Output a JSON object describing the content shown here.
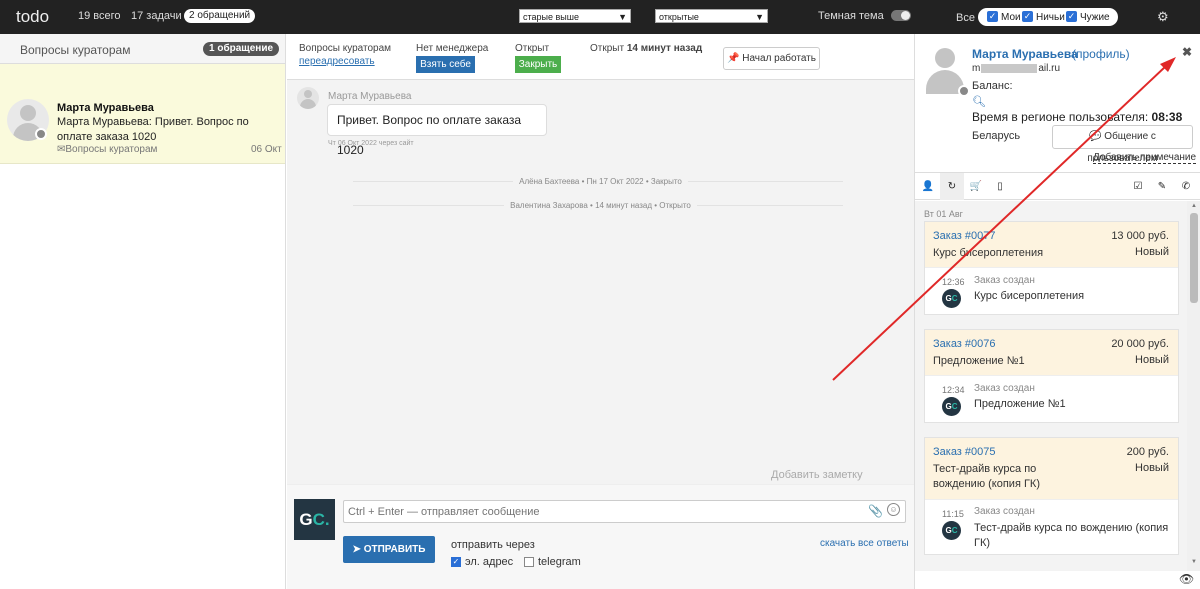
{
  "topbar": {
    "logo": "todo",
    "total": "19 всего",
    "tasks": "17 задачи",
    "requests_pill": "2 обращений",
    "sort_select": "старые выше",
    "status_select": "открытые",
    "dark_theme": "Темная тема",
    "all_label": "Все",
    "filter_mine": "Мои",
    "filter_nobody": "Ничьи",
    "filter_others": "Чужие"
  },
  "left_panel": {
    "title": "Вопросы кураторам",
    "badge": "1 обращение",
    "ticket": {
      "name": "Марта Муравьева",
      "snippet": "Марта Муравьева: Привет. Вопрос по оплате заказа 1020",
      "folder": "Вопросы кураторам",
      "date": "06 Окт"
    }
  },
  "thread_header": {
    "department_label": "Вопросы кураторам",
    "redirect_link": "переадресовать",
    "manager_label": "Нет менеджера",
    "take_button": "Взять себе",
    "state_label": "Открыт",
    "close_button": "Закрыть",
    "opened_prefix": "Открыт",
    "opened_time": "14 минут назад",
    "start_button": "Начал работать"
  },
  "thread": {
    "author": "Марта Муравьева",
    "message": "Привет. Вопрос по оплате заказа 1020",
    "meta": "Чт 06 Окт 2022 через сайт",
    "event1": "Алёна Бахтеева • Пн 17 Окт 2022 • Закрыто",
    "event2": "Валентина Захарова • 14 минут назад • Открыто",
    "add_note": "Добавить заметку"
  },
  "composer": {
    "logo_g": "G",
    "logo_c": "C.",
    "placeholder": "Ctrl + Enter — отправляет сообщение",
    "send_button": "ОТПРАВИТЬ",
    "send_via": "отправить через",
    "email_option": "эл. адрес",
    "telegram_option": "telegram",
    "download_link": "скачать все ответы"
  },
  "profile": {
    "name": "Марта Муравьева",
    "profile_link": "(профиль)",
    "email_start": "m",
    "email_end": "ail.ru",
    "balance": "Баланс:",
    "time_label": "Время в регионе пользователя:",
    "time_value": "08:38",
    "country": "Беларусь",
    "chat_button": "Общение с пользователем",
    "add_note": "Добавить примечание"
  },
  "orders": {
    "day": "Вт 01 Авг",
    "items": [
      {
        "link": "Заказ #0077",
        "price": "13 000 руб.",
        "title": "Курс бисероплетения",
        "status": "Новый",
        "time": "12:36",
        "created": "Заказ создан",
        "desc": "Курс бисероплетения"
      },
      {
        "link": "Заказ #0076",
        "price": "20 000 руб.",
        "title": "Предложение №1",
        "status": "Новый",
        "time": "12:34",
        "created": "Заказ создан",
        "desc": "Предложение №1"
      },
      {
        "link": "Заказ #0075",
        "price": "200 руб.",
        "title": "Тест-драйв курса по вождению (копия ГК)",
        "status": "Новый",
        "time": "11:15",
        "created": "Заказ создан",
        "desc": "Тест-драйв курса по вождению (копия ГК)"
      }
    ]
  },
  "colors": {
    "topbar": "#222222",
    "accent_blue": "#2a6fb0",
    "accent_green": "#4cae4c",
    "ticket_highlight": "#fafadc",
    "order_header": "#fdf3df",
    "annotation_arrow": "#e02828"
  }
}
